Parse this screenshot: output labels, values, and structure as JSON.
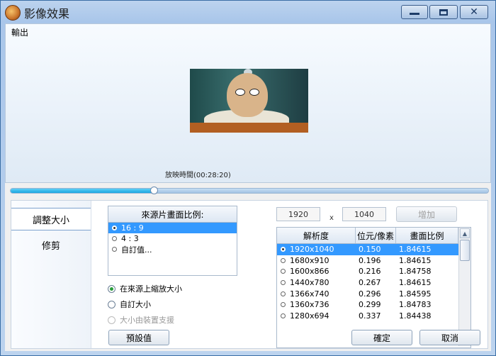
{
  "window": {
    "title": "影像效果"
  },
  "preview": {
    "output_label": "輸出",
    "timecode": "放映時間(00:28:20)",
    "progress_fraction": 0.3
  },
  "sidebar": {
    "items": [
      {
        "label": "調整大小"
      },
      {
        "label": "修剪"
      }
    ]
  },
  "aspect": {
    "header": "來源片畫面比例:",
    "options": [
      "16 : 9",
      "4 : 3",
      "自訂值..."
    ],
    "selected_index": 0
  },
  "scale_options": [
    {
      "label": "在來源上縮放大小",
      "selected": true,
      "disabled": false
    },
    {
      "label": "自訂大小",
      "selected": false,
      "disabled": false
    },
    {
      "label": "大小由裝置支援",
      "selected": false,
      "disabled": true
    }
  ],
  "custom_size": {
    "width": "1920",
    "height": "1040",
    "separator": "x",
    "add_label": "增加"
  },
  "resolution_table": {
    "headers": [
      "解析度",
      "位元/像素",
      "畫面比例"
    ],
    "rows": [
      [
        "1920x1040",
        "0.150",
        "1.84615"
      ],
      [
        "1680x910",
        "0.196",
        "1.84615"
      ],
      [
        "1600x866",
        "0.216",
        "1.84758"
      ],
      [
        "1440x780",
        "0.267",
        "1.84615"
      ],
      [
        "1366x740",
        "0.296",
        "1.84595"
      ],
      [
        "1360x736",
        "0.299",
        "1.84783"
      ],
      [
        "1280x694",
        "0.337",
        "1.84438"
      ]
    ],
    "selected_index": 0
  },
  "buttons": {
    "defaults": "預設值",
    "ok": "確定",
    "cancel": "取消"
  }
}
